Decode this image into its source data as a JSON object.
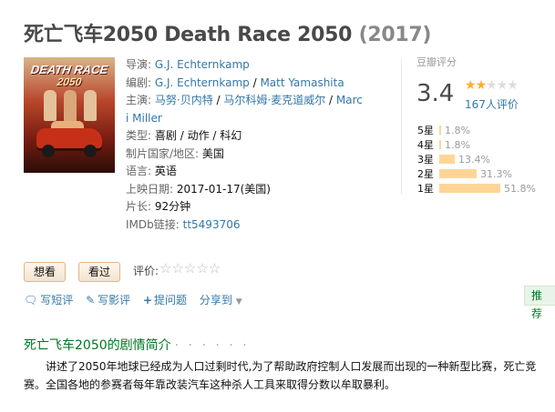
{
  "movie": {
    "title": "死亡飞车2050 Death Race 2050",
    "year": "(2017)",
    "poster": {
      "line1": "DEATH RACE",
      "line2": "2050"
    }
  },
  "info": {
    "director_label": "导演:",
    "director": "G.J. Echternkamp",
    "writer_label": "编剧:",
    "writer1": "G.J. Echternkamp",
    "writer_sep": " / ",
    "writer2": "Matt Yamashita",
    "cast_label": "主演:",
    "cast1": "马努·贝内特",
    "cast_sep": " / ",
    "cast2": "马尔科姆·麦克道威尔",
    "cast3_part1": "Marc",
    "cast3_part2": "i Miller",
    "genre_label": "类型:",
    "genre1": "喜剧",
    "genre2": "动作",
    "genre3": "科幻",
    "genre_sep": " / ",
    "country_label": "制片国家/地区:",
    "country": "美国",
    "language_label": "语言:",
    "language": "英语",
    "release_label": "上映日期:",
    "release": "2017-01-17(美国)",
    "runtime_label": "片长:",
    "runtime": "92分钟",
    "imdb_label": "IMDb链接:",
    "imdb": "tt5493706"
  },
  "rating": {
    "header": "豆瓣评分",
    "score": "3.4",
    "stars_filled": 2,
    "stars_total": 5,
    "count": "167人评价",
    "distribution": [
      {
        "label": "5星",
        "percent": 1.8,
        "text": "1.8%"
      },
      {
        "label": "4星",
        "percent": 1.8,
        "text": "1.8%"
      },
      {
        "label": "3星",
        "percent": 13.4,
        "text": "13.4%"
      },
      {
        "label": "2星",
        "percent": 31.3,
        "text": "31.3%"
      },
      {
        "label": "1星",
        "percent": 51.8,
        "text": "51.8%"
      }
    ]
  },
  "buttons": {
    "want": "想看",
    "seen": "看过",
    "rate_label": "评价:",
    "rate_stars": "☆☆☆☆☆"
  },
  "actions": {
    "short_review": "写短评",
    "review": "写影评",
    "question": "提问题",
    "share": "分享到",
    "recommend": "推荐"
  },
  "synopsis": {
    "heading": "死亡飞车2050的剧情简介",
    "dots": "· · · · · ·",
    "text": "讲述了2050年地球已经成为人口过剩时代,为了帮助政府控制人口发展而出现的一种新型比赛，死亡竞赛。全国各地的参赛者每年靠改装汽车这种杀人工具来取得分数以牟取暴利。"
  }
}
